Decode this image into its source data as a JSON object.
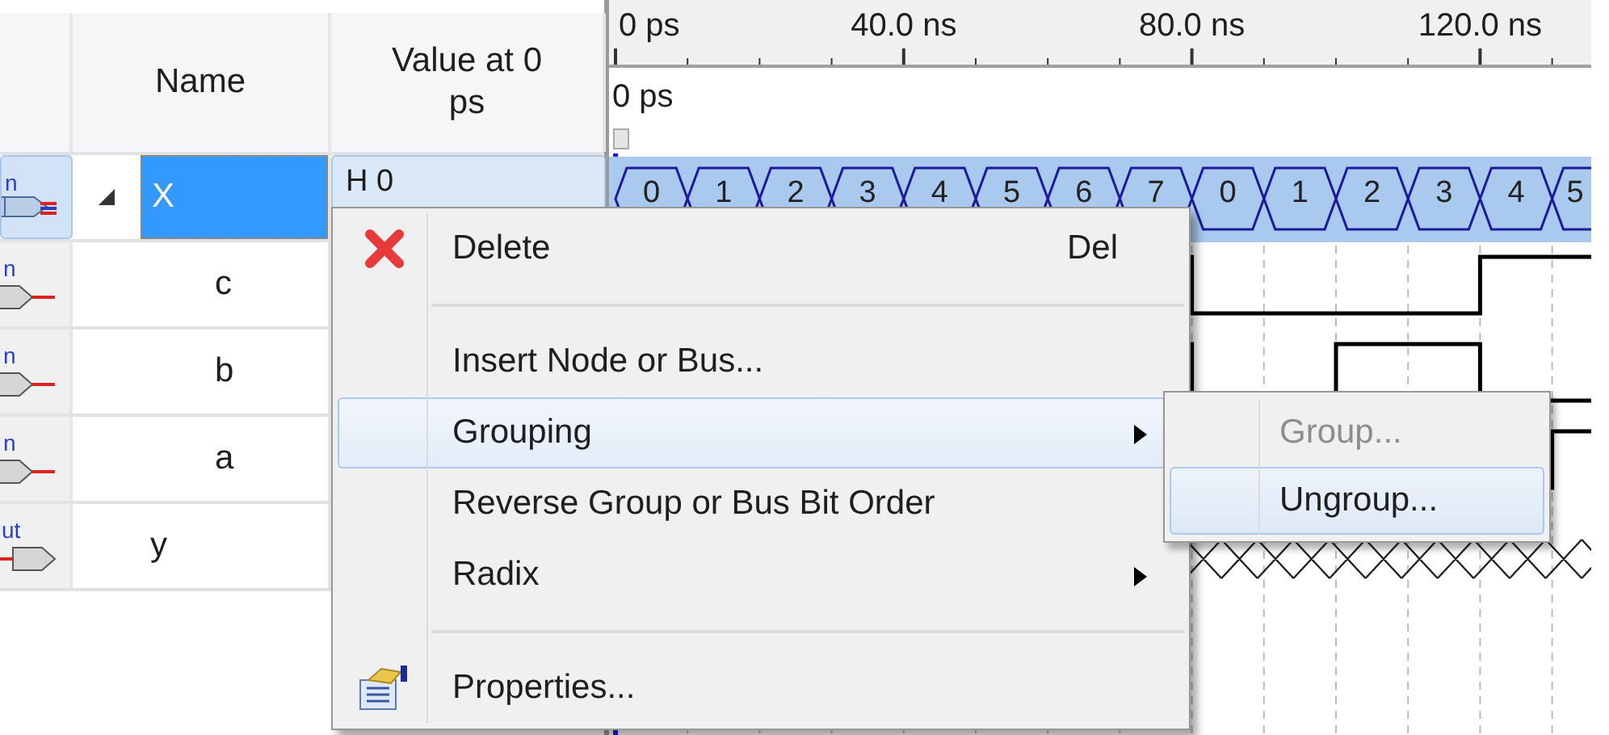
{
  "columns": [
    {
      "label": "Name"
    },
    {
      "label": "Value at 0 ps"
    }
  ],
  "signals": [
    {
      "kind": "bus",
      "pin_label": "n",
      "name": "X",
      "value": "H 0",
      "selected": true,
      "expanded": true,
      "children": [
        {
          "kind": "input",
          "pin_label": "n",
          "name": "c",
          "selected": false
        },
        {
          "kind": "input",
          "pin_label": "n",
          "name": "b",
          "selected": false
        },
        {
          "kind": "input",
          "pin_label": "n",
          "name": "a",
          "selected": false
        }
      ]
    },
    {
      "kind": "output",
      "pin_label": "ut",
      "name": "y",
      "selected": false
    }
  ],
  "timeline": {
    "ticks": [
      "0 ps",
      "40.0 ns",
      "80.0 ns",
      "120.0 ns"
    ],
    "cursor_label": "0 ps"
  },
  "bus_values": [
    "0",
    "1",
    "2",
    "3",
    "4",
    "5",
    "6",
    "7",
    "0",
    "1",
    "2",
    "3",
    "4",
    "5"
  ],
  "context_menu": {
    "items": [
      {
        "kind": "item",
        "label": "Delete",
        "shortcut": "Del",
        "selected": false
      },
      {
        "kind": "separator"
      },
      {
        "kind": "item",
        "label": "Insert Node or Bus...",
        "selected": false
      },
      {
        "kind": "item",
        "label": "Grouping",
        "submenu": true,
        "selected": true
      },
      {
        "kind": "item",
        "label": "Reverse Group or Bus Bit Order",
        "selected": false
      },
      {
        "kind": "item",
        "label": "Radix",
        "submenu": true,
        "selected": false
      },
      {
        "kind": "separator"
      },
      {
        "kind": "item",
        "label": "Properties...",
        "selected": false
      }
    ]
  },
  "submenu": {
    "items": [
      {
        "label": "Group...",
        "disabled": true,
        "selected": false
      },
      {
        "label": "Ungroup...",
        "disabled": false,
        "selected": true
      }
    ]
  }
}
